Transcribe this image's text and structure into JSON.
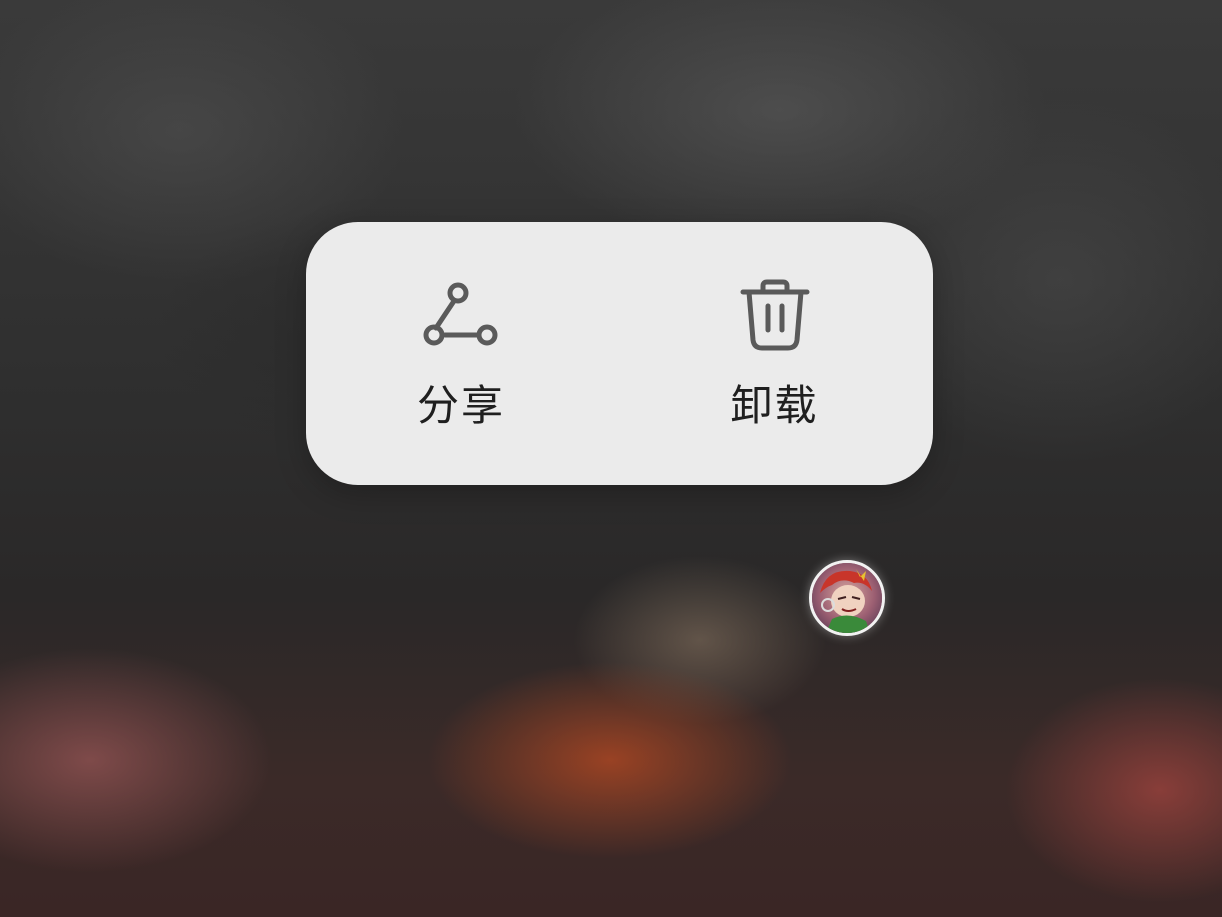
{
  "context_menu": {
    "items": [
      {
        "label": "分享",
        "icon": "share-icon"
      },
      {
        "label": "卸载",
        "icon": "trash-icon"
      }
    ]
  },
  "colors": {
    "menu_background": "#ebebeb",
    "icon_color": "#5a5a5a",
    "label_color": "#1f1f1f"
  },
  "avatar": {
    "icon": "user-avatar"
  }
}
